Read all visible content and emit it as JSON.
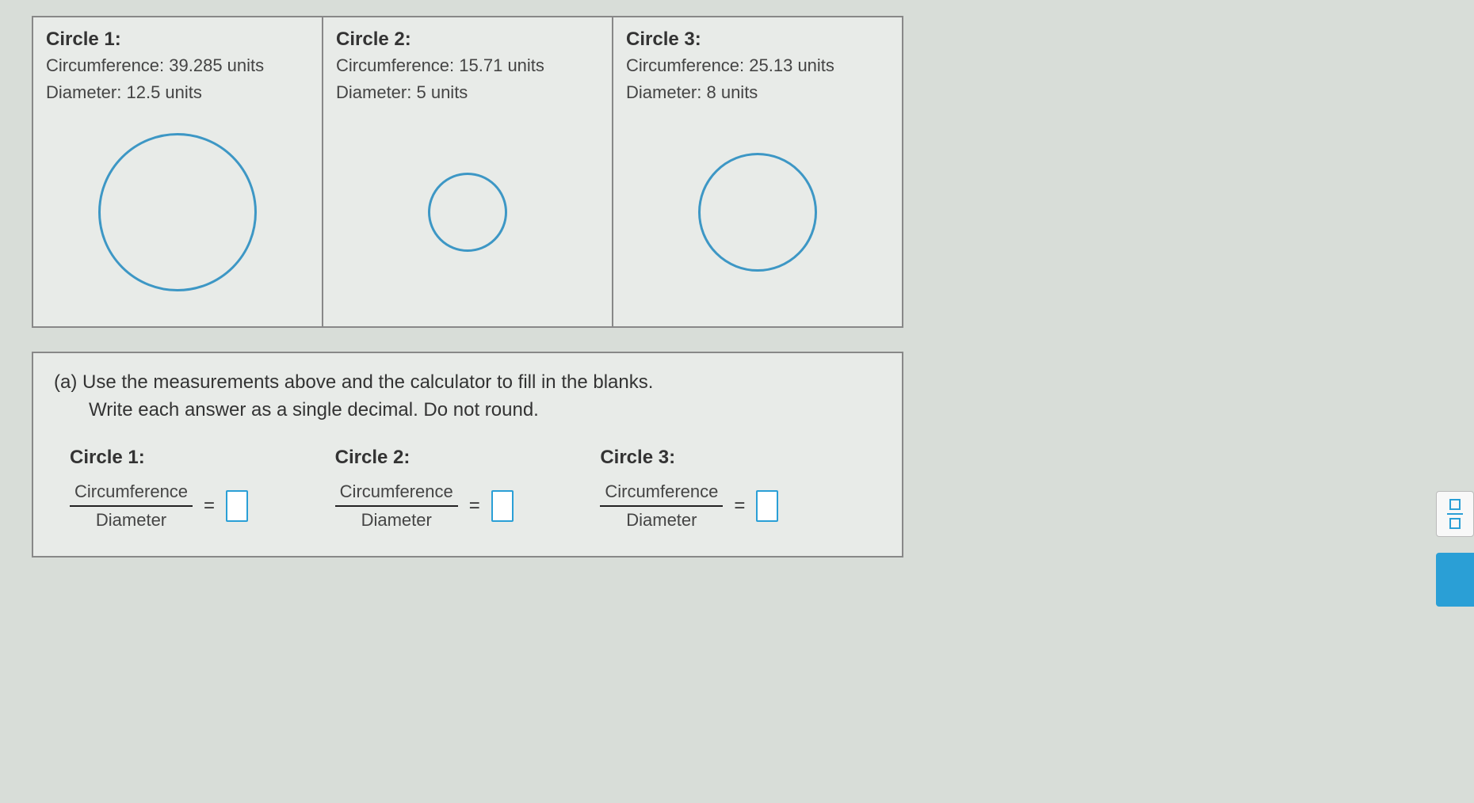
{
  "circles": [
    {
      "title": "Circle 1:",
      "circumference_label": "Circumference:",
      "circumference_value": "39.285 units",
      "diameter_label": "Diameter:",
      "diameter_value": "12.5 units"
    },
    {
      "title": "Circle 2:",
      "circumference_label": "Circumference:",
      "circumference_value": "15.71 units",
      "diameter_label": "Diameter:",
      "diameter_value": "5 units"
    },
    {
      "title": "Circle 3:",
      "circumference_label": "Circumference:",
      "circumference_value": "25.13 units",
      "diameter_label": "Diameter:",
      "diameter_value": "8 units"
    }
  ],
  "question": {
    "line1": "(a) Use the measurements above and the calculator to fill in the blanks.",
    "line2": "Write each answer as a single decimal. Do not round."
  },
  "answers": [
    {
      "title": "Circle 1:",
      "numerator": "Circumference",
      "denominator": "Diameter",
      "equals": "="
    },
    {
      "title": "Circle 2:",
      "numerator": "Circumference",
      "denominator": "Diameter",
      "equals": "="
    },
    {
      "title": "Circle 3:",
      "numerator": "Circumference",
      "denominator": "Diameter",
      "equals": "="
    }
  ]
}
